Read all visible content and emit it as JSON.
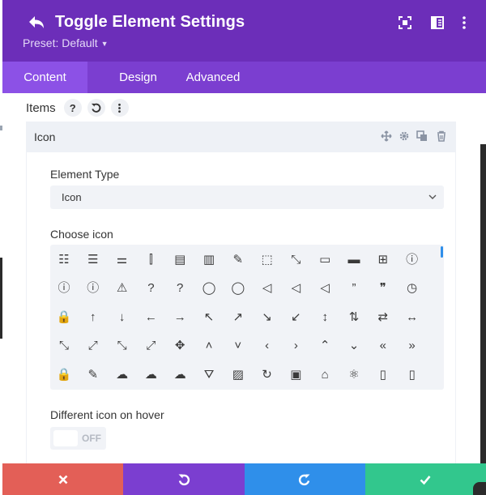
{
  "header": {
    "title": "Toggle Element Settings",
    "preset_label": "Preset: Default",
    "color": "#6c2eb9"
  },
  "tabs": [
    {
      "label": "Content",
      "active": true
    },
    {
      "label": "Design",
      "active": false
    },
    {
      "label": "Advanced",
      "active": false
    }
  ],
  "items": {
    "label": "Items",
    "help_label": "?"
  },
  "card": {
    "title": "Icon"
  },
  "element_type": {
    "label": "Element Type",
    "value": "Icon"
  },
  "choose_icon": {
    "label": "Choose icon",
    "rows": [
      [
        "list-bullets-icon",
        "list-numbered-icon",
        "sliders-horizontal-icon",
        "sliders-vertical-icon",
        "document-icon",
        "document-alt-icon",
        "pencil-icon",
        "pencil-box-icon",
        "pencil-box-alt-icon",
        "folder-icon",
        "folder-open-icon",
        "folder-add-icon",
        "info-circle-icon"
      ],
      [
        "alert-circle-icon",
        "alert-circle-alt-icon",
        "warning-triangle-icon",
        "question-circle-icon",
        "question-icon",
        "speech-bubble-icon",
        "speech-bubbles-icon",
        "volume-mute-icon",
        "volume-low-icon",
        "volume-high-icon",
        "quote-close-icon",
        "quote-circle-icon",
        "clock-icon"
      ],
      [
        "lock-icon",
        "arrow-up-icon",
        "arrow-down-icon",
        "arrow-left-icon",
        "arrow-right-icon",
        "arrow-up-left-icon",
        "arrow-up-right-icon",
        "arrow-down-right-icon",
        "arrow-down-left-icon",
        "arrow-up-down-icon",
        "arrow-up-down-alt-icon",
        "arrow-left-right-alt-icon",
        "arrow-left-right-icon"
      ],
      [
        "expand-diagonal-icon",
        "expand-diagonal-alt-icon",
        "contract-icon",
        "expand-icon",
        "move-icon",
        "chevron-up-icon",
        "chevron-down-icon",
        "chevron-left-icon",
        "chevron-right-icon",
        "double-chevron-up-icon",
        "double-chevron-down-icon",
        "double-chevron-left-icon",
        "double-chevron-right-icon"
      ],
      [
        "lock-alt-icon",
        "brush-icon",
        "cloud-icon",
        "cloud-upload-icon",
        "cloud-download-icon",
        "faucet-icon",
        "image-icon",
        "refresh-icon",
        "gift-icon",
        "home-icon",
        "atom-icon",
        "mobile-icon",
        "tablet-icon"
      ]
    ],
    "glyphs": [
      [
        "☷",
        "☰",
        "⚌",
        "⫿",
        "▤",
        "▥",
        "✎",
        "⬚",
        "⤡",
        "▭",
        "▬",
        "⊞",
        "ⓘ"
      ],
      [
        "ⓘ",
        "ⓘ",
        "⚠",
        "?",
        "?",
        "◯",
        "◯",
        "◁",
        "◁",
        "◁",
        "”",
        "❞",
        "◷"
      ],
      [
        "🔒",
        "↑",
        "↓",
        "←",
        "→",
        "↖",
        "↗",
        "↘",
        "↙",
        "↕",
        "⇅",
        "⇄",
        "↔"
      ],
      [
        "⤡",
        "⤢",
        "⤡",
        "⤢",
        "✥",
        "˄",
        "˅",
        "‹",
        "›",
        "⌃",
        "⌄",
        "«",
        "»"
      ],
      [
        "🔒",
        "✎",
        "☁",
        "☁",
        "☁",
        "⛛",
        "▨",
        "↻",
        "▣",
        "⌂",
        "⚛",
        "▯",
        "▯"
      ]
    ]
  },
  "hover": {
    "label": "Different icon on hover",
    "toggle_text": "OFF"
  },
  "footer": {
    "buttons": [
      {
        "name": "discard",
        "color": "#e35f57"
      },
      {
        "name": "undo",
        "color": "#7b3ed0"
      },
      {
        "name": "redo",
        "color": "#2f8fea"
      },
      {
        "name": "save",
        "color": "#32c78d"
      }
    ]
  }
}
